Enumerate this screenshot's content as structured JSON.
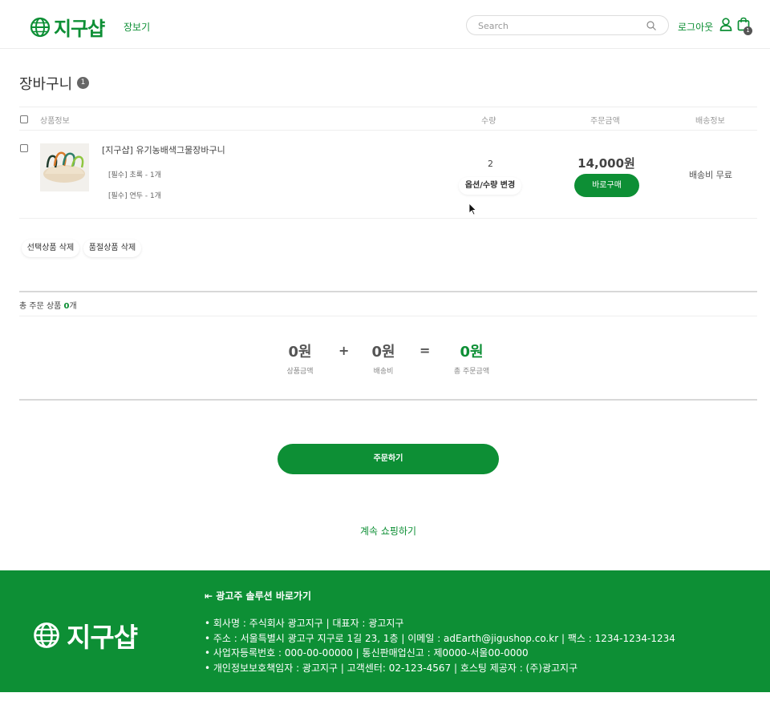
{
  "header": {
    "logo_text": "지구샵",
    "nav_shop": "장보기",
    "search_placeholder": "Search",
    "logout": "로그아웃",
    "bag_count": "1"
  },
  "cart": {
    "title": "장바구니",
    "count": "1",
    "columns": {
      "product": "상품정보",
      "quantity": "수량",
      "price": "주문금액",
      "shipping": "배송정보"
    },
    "item": {
      "name": "[지구샵] 유기농배색그물장바구니",
      "options": [
        "[필수] 초록 - 1개",
        "[필수] 연두 - 1개"
      ],
      "quantity": "2",
      "change_option": "옵션/수량 변경",
      "price": "14,000원",
      "buy_now": "바로구매",
      "shipping": "배송비 무료"
    },
    "delete_selected": "선택상품 삭제",
    "delete_soldout": "품절상품 삭제"
  },
  "summary": {
    "count_prefix": "총 주문 상품 ",
    "count_value": "0",
    "count_suffix": "개",
    "product_amount": "0원",
    "product_amount_label": "상품금액",
    "plus": "+",
    "shipping_amount": "0원",
    "shipping_label": "배송비",
    "equals": "=",
    "total_amount": "0원",
    "total_label": "총 주문금액"
  },
  "actions": {
    "order": "주문하기",
    "continue": "계속 쇼핑하기"
  },
  "footer": {
    "logo_text": "지구샵",
    "solution_link": "⇤ 광고주 솔루션 바로가기",
    "info": [
      "• 회사명 : 주식회사 광고지구 | 대표자 : 광고지구",
      "• 주소 : 서울특별시 광고구 지구로 1길 23, 1층 | 이메일 : adEarth@jigushop.co.kr | 팩스 : 1234-1234-1234",
      "• 사업자등록번호 : 000-00-00000 | 통신판매업신고 : 제0000-서울00-0000",
      "• 개인정보보호책임자 : 광고지구 | 고객센터: 02-123-4567 | 호스팅 제공자 : (주)광고지구"
    ]
  },
  "colors": {
    "brand_green": "#0d8f35"
  }
}
